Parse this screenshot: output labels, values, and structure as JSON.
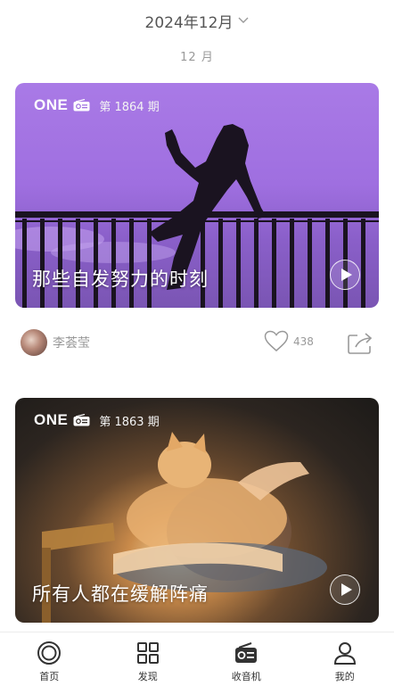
{
  "header": {
    "month_selector": "2024年12月",
    "section_month": "12 月"
  },
  "brand": {
    "name": "ONE"
  },
  "cards": [
    {
      "issue": "第 1864 期",
      "title": "那些自发努力的时刻",
      "art": "silhouette-woman-on-railing"
    },
    {
      "issue": "第 1863 期",
      "title": "所有人都在缓解阵痛",
      "art": "cat-in-lap-sunlight"
    }
  ],
  "author": {
    "name": "李荟莹",
    "likes": "438"
  },
  "tabs": [
    {
      "label": "首页",
      "icon": "home-icon"
    },
    {
      "label": "发现",
      "icon": "grid-icon"
    },
    {
      "label": "收音机",
      "icon": "radio-icon"
    },
    {
      "label": "我的",
      "icon": "person-icon"
    }
  ],
  "colors": {
    "card1_bg": "#a97ae6",
    "card2_bg": "#2c2520",
    "text_secondary": "#999999"
  }
}
